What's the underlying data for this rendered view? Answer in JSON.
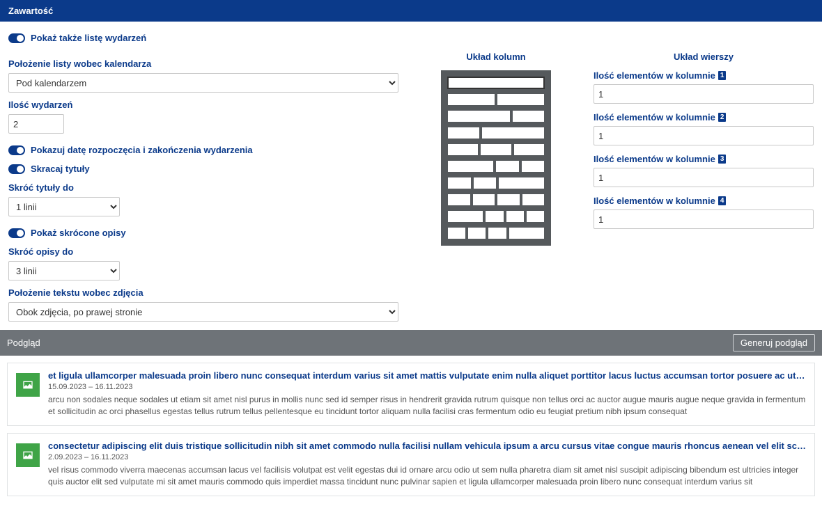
{
  "section_title": "Zawartość",
  "toggles": {
    "show_events": "Pokaż także listę wydarzeń",
    "show_dates": "Pokazuj datę rozpoczęcia i zakończenia wydarzenia",
    "truncate_titles": "Skracaj tytuły",
    "show_short_desc": "Pokaż skrócone opisy"
  },
  "labels": {
    "list_position": "Położenie listy wobec kalendarza",
    "event_count": "Ilość wydarzeń",
    "truncate_titles_to": "Skróć tytuły do",
    "truncate_desc_to": "Skróć opisy do",
    "text_position": "Położenie tekstu wobec zdjęcia",
    "col_layout": "Układ kolumn",
    "row_layout": "Układ wierszy",
    "row_count_prefix": "Ilość elementów w kolumnie"
  },
  "values": {
    "list_position": "Pod kalendarzem",
    "event_count": "2",
    "truncate_titles_to": "1 linii",
    "truncate_desc_to": "3 linii",
    "text_position": "Obok zdjęcia, po prawej stronie"
  },
  "row_counts": [
    {
      "badge": "1",
      "value": "1"
    },
    {
      "badge": "2",
      "value": "1"
    },
    {
      "badge": "3",
      "value": "1"
    },
    {
      "badge": "4",
      "value": "1"
    }
  ],
  "preview": {
    "title": "Podgląd",
    "button": "Generuj podgląd",
    "items": [
      {
        "title": "et ligula ullamcorper malesuada proin libero nunc consequat interdum varius sit amet mattis vulputate enim nulla aliquet porttitor lacus luctus accumsan tortor posuere ac ut consequat semper viverra nam...",
        "dates": "15.09.2023 – 16.11.2023",
        "desc": "arcu non sodales neque sodales ut etiam sit amet nisl purus in mollis nunc sed id semper risus in hendrerit gravida rutrum quisque non tellus orci ac auctor augue mauris augue neque gravida in fermentum et sollicitudin ac orci phasellus egestas tellus rutrum tellus pellentesque eu tincidunt tortor aliquam nulla facilisi cras fermentum odio eu feugiat pretium nibh ipsum consequat"
      },
      {
        "title": "consectetur adipiscing elit duis tristique sollicitudin nibh sit amet commodo nulla facilisi nullam vehicula ipsum a arcu cursus vitae congue mauris rhoncus aenean vel elit scelerisque mauris pellentesque...",
        "dates": "2.09.2023 – 16.11.2023",
        "desc": "vel risus commodo viverra maecenas accumsan lacus vel facilisis volutpat est velit egestas dui id ornare arcu odio ut sem nulla pharetra diam sit amet nisl suscipit adipiscing bibendum est ultricies integer quis auctor elit sed vulputate mi sit amet mauris commodo quis imperdiet massa tincidunt nunc pulvinar sapien et ligula ullamcorper malesuada proin libero nunc consequat interdum varius sit"
      }
    ]
  }
}
